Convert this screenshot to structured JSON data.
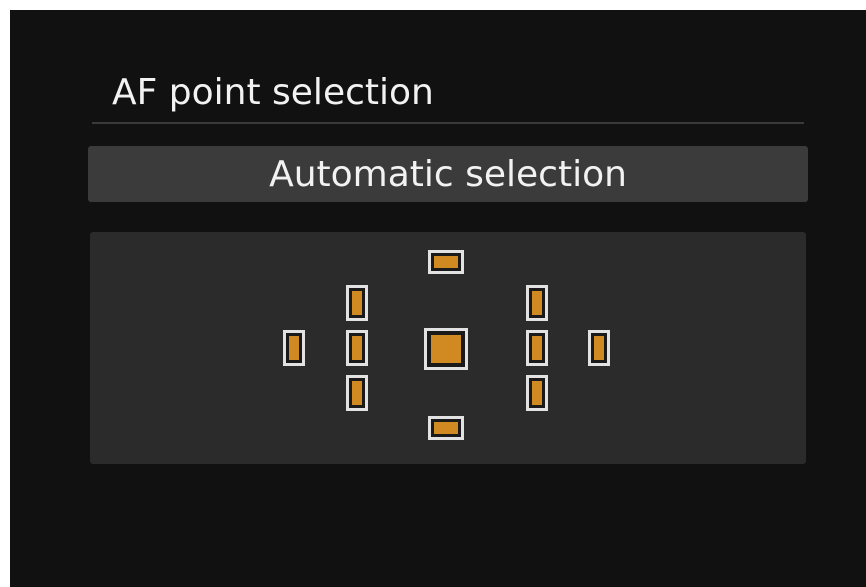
{
  "header": {
    "title": "AF point selection"
  },
  "mode": {
    "label": "Automatic selection"
  },
  "af_points": {
    "fill_color": "#d18a22",
    "border_color": "#e2e2e2",
    "items": [
      {
        "id": "top",
        "orientation": "horizontal",
        "selected": true
      },
      {
        "id": "upper-left",
        "orientation": "vertical",
        "selected": true
      },
      {
        "id": "upper-right",
        "orientation": "vertical",
        "selected": true
      },
      {
        "id": "far-left",
        "orientation": "vertical",
        "selected": true
      },
      {
        "id": "mid-left",
        "orientation": "vertical",
        "selected": true
      },
      {
        "id": "center",
        "orientation": "cross",
        "selected": true
      },
      {
        "id": "mid-right",
        "orientation": "vertical",
        "selected": true
      },
      {
        "id": "far-right",
        "orientation": "vertical",
        "selected": true
      },
      {
        "id": "lower-left",
        "orientation": "vertical",
        "selected": true
      },
      {
        "id": "lower-right",
        "orientation": "vertical",
        "selected": true
      },
      {
        "id": "bottom",
        "orientation": "horizontal",
        "selected": true
      }
    ]
  }
}
